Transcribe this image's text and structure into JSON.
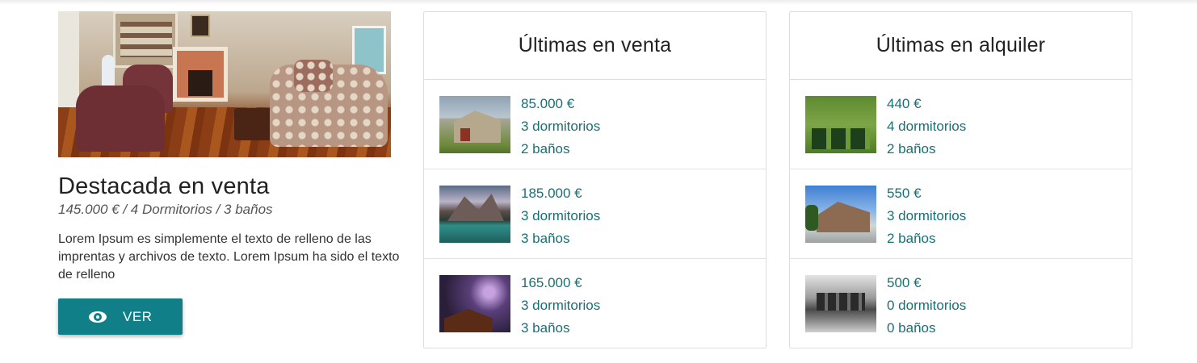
{
  "featured": {
    "title": "Destacada en venta",
    "subtitle": "145.000 € / 4 Dormitorios / 3 baños",
    "description": "Lorem Ipsum es simplemente el texto de relleno de las imprentas y archivos de texto. Lorem Ipsum ha sido el texto de relleno",
    "button_label": "VER",
    "button_icon": "eye-icon",
    "image": "living-room-photo"
  },
  "sale": {
    "title": "Últimas en venta",
    "items": [
      {
        "price": "85.000 €",
        "bedrooms": "3 dormitorios",
        "bathrooms": "2 baños",
        "image": "barn-photo"
      },
      {
        "price": "185.000 €",
        "bedrooms": "3 dormitorios",
        "bathrooms": "3 baños",
        "image": "mountain-lake-photo"
      },
      {
        "price": "165.000 €",
        "bedrooms": "3 dormitorios",
        "bathrooms": "3 baños",
        "image": "storm-barn-photo"
      }
    ]
  },
  "rent": {
    "title": "Últimas en alquiler",
    "items": [
      {
        "price": "440 €",
        "bedrooms": "4 dormitorios",
        "bathrooms": "2 baños",
        "image": "ivy-house-photo"
      },
      {
        "price": "550 €",
        "bedrooms": "3 dormitorios",
        "bathrooms": "2 baños",
        "image": "suburban-house-photo"
      },
      {
        "price": "500 €",
        "bedrooms": "0 dormitorios",
        "bathrooms": "0 baños",
        "image": "garage-photo"
      }
    ]
  },
  "colors": {
    "accent": "#117f87",
    "link": "#1a6f74",
    "border": "#dedede"
  }
}
